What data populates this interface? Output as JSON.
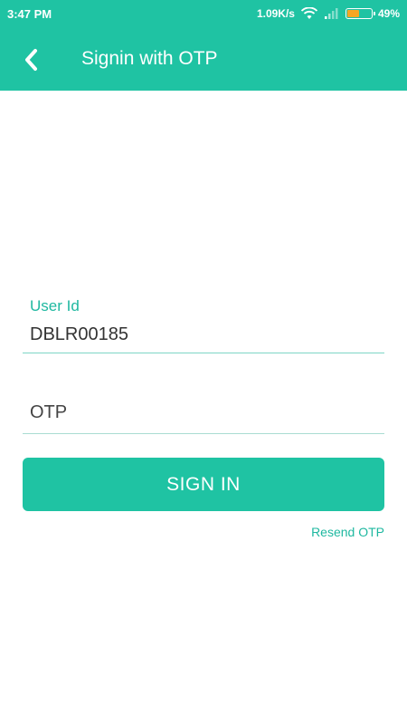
{
  "status_bar": {
    "time": "3:47 PM",
    "network_speed": "1.09K/s",
    "battery_percent": "49%",
    "battery_level": 0.49,
    "icons": [
      "wifi-icon",
      "signal-icon",
      "battery-icon"
    ]
  },
  "app_bar": {
    "title": "Signin with OTP",
    "back_icon": "chevron-left-icon",
    "color": "#1fc3a3"
  },
  "form": {
    "user_id": {
      "label": "User Id",
      "value": "DBLR00185"
    },
    "otp": {
      "placeholder": "OTP",
      "value": ""
    },
    "submit_label": "SIGN IN",
    "resend_label": "Resend OTP"
  },
  "colors": {
    "accent": "#1fc3a3",
    "accent_text": "#1fb8a0",
    "battery": "#f5a623"
  }
}
